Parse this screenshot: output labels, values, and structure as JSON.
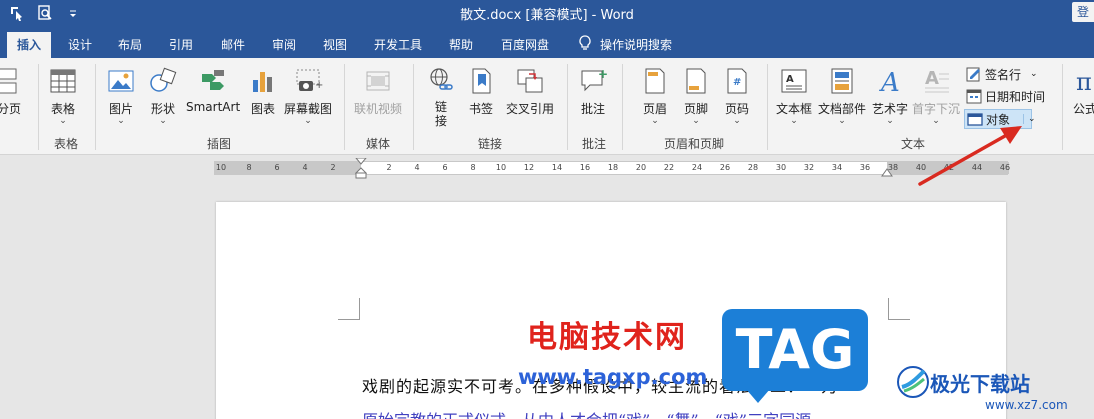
{
  "window": {
    "title": "散文.docx [兼容模式] - Word",
    "account_label": "登"
  },
  "tabs": [
    {
      "label": "插入",
      "active": true
    },
    {
      "label": "设计"
    },
    {
      "label": "布局"
    },
    {
      "label": "引用"
    },
    {
      "label": "邮件"
    },
    {
      "label": "审阅"
    },
    {
      "label": "视图"
    },
    {
      "label": "开发工具"
    },
    {
      "label": "帮助"
    },
    {
      "label": "百度网盘"
    },
    {
      "label": "操作说明搜索"
    }
  ],
  "ribbon": {
    "pages": {
      "button": "分页"
    },
    "table": {
      "button": "表格",
      "group": "表格"
    },
    "illustrations": {
      "group": "插图",
      "pictures": "图片",
      "shapes": "形状",
      "smartart": "SmartArt",
      "chart": "图表",
      "screenshot": "屏幕截图"
    },
    "media": {
      "group": "媒体",
      "online_video": "联机视频"
    },
    "links": {
      "group": "链接",
      "link": "链接",
      "bookmark": "书签",
      "crossref": "交叉引用"
    },
    "comments": {
      "group": "批注",
      "comment": "批注"
    },
    "header_footer": {
      "group": "页眉和页脚",
      "header": "页眉",
      "footer": "页脚",
      "page_number": "页码"
    },
    "text": {
      "group": "文本",
      "textbox": "文本框",
      "quickparts": "文档部件",
      "wordart": "艺术字",
      "dropcap": "首字下沉",
      "signature": "签名行",
      "datetime": "日期和时间",
      "object": "对象"
    },
    "symbols": {
      "equation": "公式"
    }
  },
  "ruler": {
    "left_ticks": [
      "10",
      "8",
      "6",
      "4",
      "2"
    ],
    "right_ticks": [
      "2",
      "4",
      "6",
      "8",
      "10",
      "12",
      "14",
      "16",
      "18",
      "20",
      "22",
      "24",
      "26",
      "28",
      "30",
      "32",
      "34",
      "36",
      "38",
      "40",
      "42",
      "44",
      "46"
    ]
  },
  "document": {
    "line1": "戏剧的起源实不可考。在多种假设中，较主流的看法有二：一为",
    "line2": "原始宗教的正式仪式，从中人才会把“戏”、“舞”、“戏”三字同源"
  },
  "watermarks": {
    "site_cn": "电脑技术网",
    "site_url": "www.tagxp.com",
    "tag": "TAG",
    "jg_name": "极光下载站",
    "jg_url": "www.xz7.com"
  },
  "colors": {
    "title_bar": "#2b579a",
    "ribbon": "#f3f3f3",
    "arrow": "#d92a20"
  }
}
